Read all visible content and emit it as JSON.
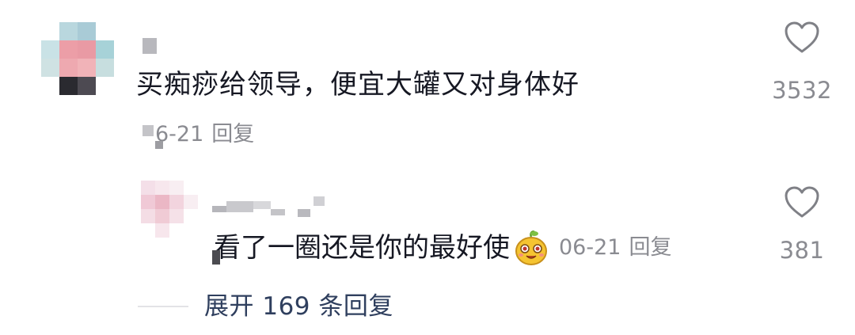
{
  "comment": {
    "text": "买痴痧给领导，便宜大罐又对身体好",
    "date": "6-21",
    "reply_label": "回复",
    "likes": "3532"
  },
  "reply": {
    "text": "看了一圈还是你的最好使",
    "date": "06-21",
    "reply_label": "回复",
    "likes": "381"
  },
  "expand": {
    "label": "展开 169 条回复"
  },
  "colors": {
    "text_primary": "#161823",
    "text_secondary": "#8a8b91",
    "link": "#2f3f5e"
  },
  "icons": {
    "like": "heart-outline-icon",
    "emoji": "smiling-face-emoji-icon"
  }
}
